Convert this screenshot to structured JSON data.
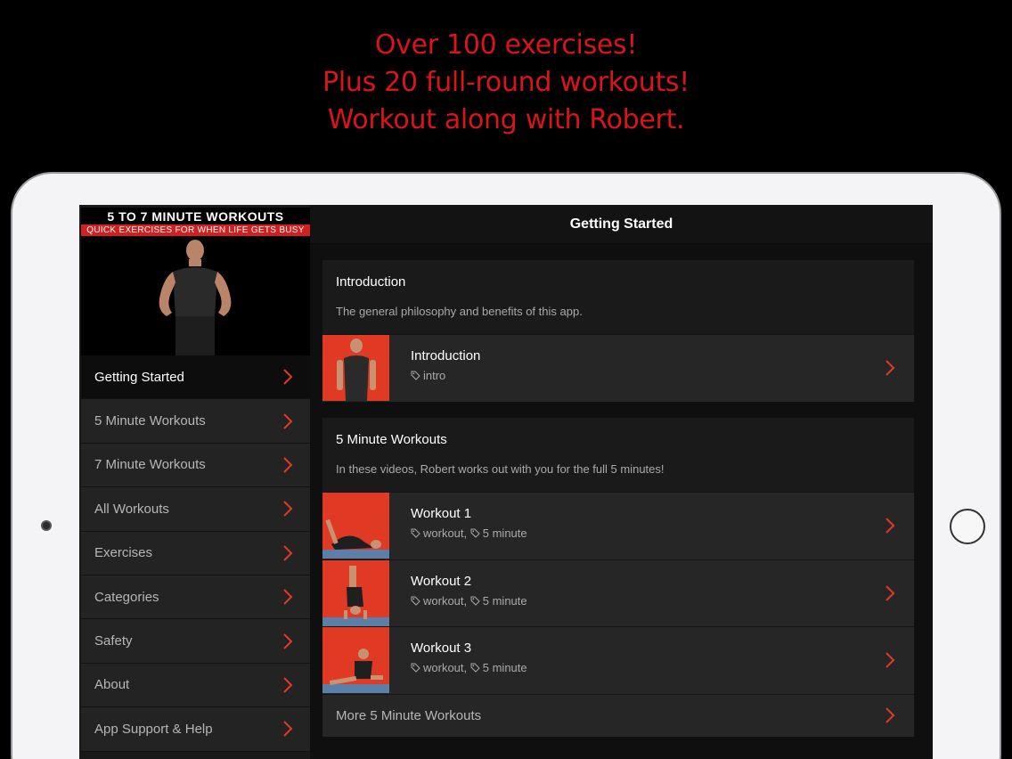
{
  "promo": {
    "lines": [
      "Over 100 exercises!",
      "Plus 20 full-round workouts!",
      "Workout along with Robert."
    ]
  },
  "colors": {
    "accent": "#e03a24",
    "promo_red": "#d9141a",
    "background": "#000000"
  },
  "sidebar": {
    "banner_title": "5 TO 7 MINUTE WORKOUTS",
    "banner_subtitle": "QUICK EXERCISES FOR WHEN LIFE GETS BUSY",
    "items": [
      {
        "label": "Getting Started",
        "active": true
      },
      {
        "label": "5 Minute Workouts"
      },
      {
        "label": "7 Minute Workouts"
      },
      {
        "label": "All Workouts"
      },
      {
        "label": "Exercises"
      },
      {
        "label": "Categories"
      },
      {
        "label": "Safety"
      },
      {
        "label": "About"
      },
      {
        "label": "App Support & Help"
      }
    ]
  },
  "header": {
    "title": "Getting Started"
  },
  "main": {
    "sections": [
      {
        "title": "Introduction",
        "description": "The general philosophy and benefits of this app.",
        "rows": [
          {
            "title": "Introduction",
            "tags": [
              "intro"
            ]
          }
        ]
      },
      {
        "title": "5 Minute Workouts",
        "description": "In these videos, Robert works out with you for the full 5 minutes!",
        "rows": [
          {
            "title": "Workout 1",
            "tags": [
              "workout",
              "5 minute"
            ]
          },
          {
            "title": "Workout 2",
            "tags": [
              "workout",
              "5 minute"
            ]
          },
          {
            "title": "Workout 3",
            "tags": [
              "workout",
              "5 minute"
            ]
          }
        ],
        "more_label": "More 5 Minute Workouts"
      }
    ]
  },
  "icons": {
    "chevron": "chevron-right-icon",
    "tag": "tag-icon"
  }
}
